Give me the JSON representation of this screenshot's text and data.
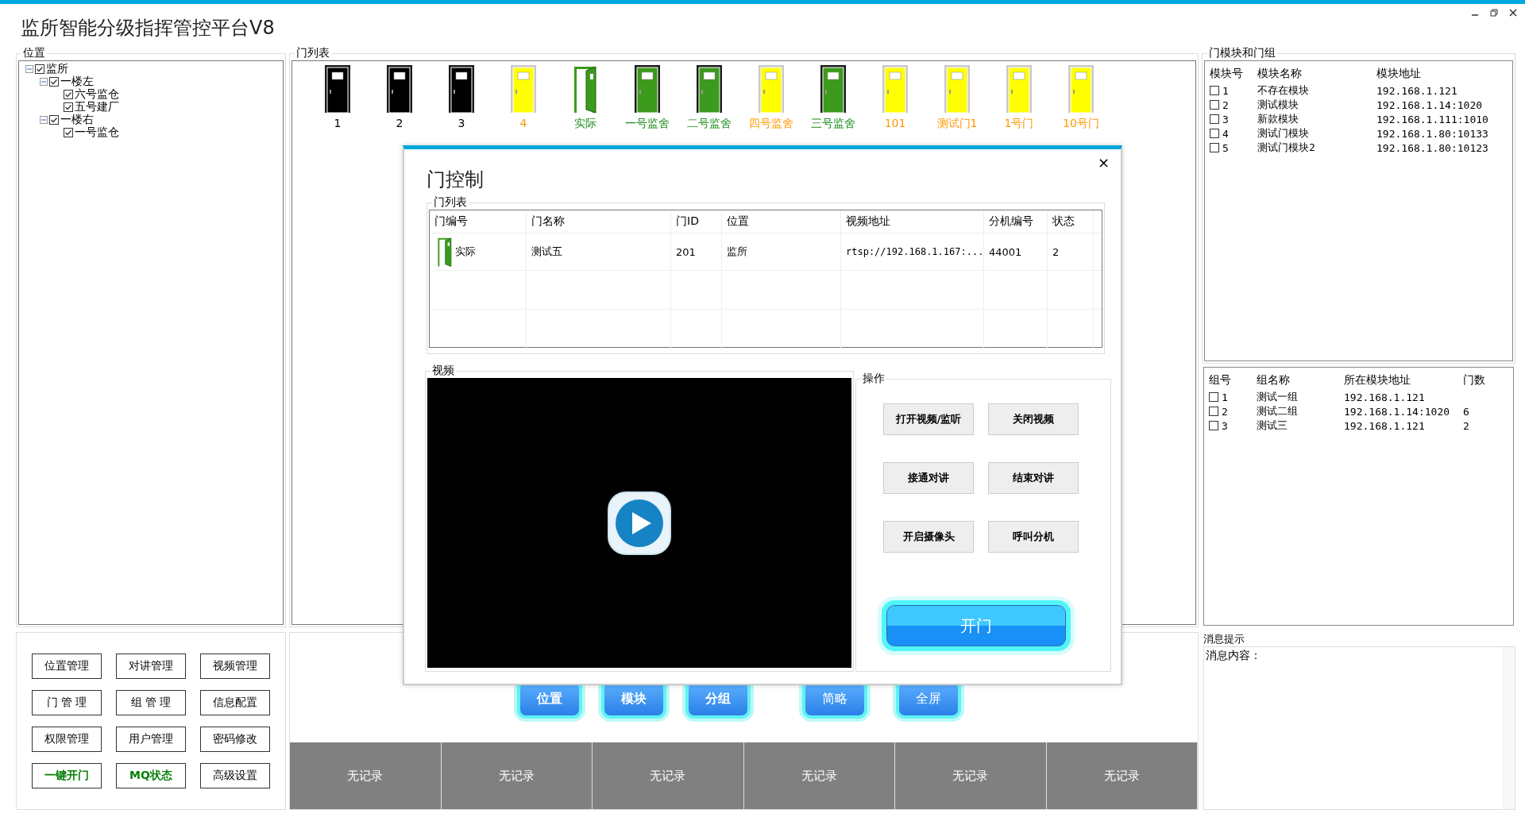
{
  "window": {
    "title": "监所智能分级指挥管控平台V8",
    "controls": [
      {
        "kind": "minimize"
      },
      {
        "kind": "restore"
      },
      {
        "kind": "close"
      }
    ]
  },
  "location": {
    "title": "位置",
    "tree": [
      {
        "label": "监所",
        "checked": true,
        "expanded": true,
        "children": [
          {
            "label": "一楼左",
            "checked": true,
            "expanded": true,
            "children": [
              {
                "label": "六号监仓",
                "checked": true
              },
              {
                "label": "五号建厂",
                "checked": true
              }
            ]
          },
          {
            "label": "一楼右",
            "checked": true,
            "expanded": true,
            "children": [
              {
                "label": "一号监仓",
                "checked": true
              }
            ]
          }
        ]
      }
    ]
  },
  "door_list": {
    "title": "门列表",
    "doors": [
      {
        "label": "1",
        "kind": "closed",
        "color": "#000000"
      },
      {
        "label": "2",
        "kind": "closed",
        "color": "#000000"
      },
      {
        "label": "3",
        "kind": "closed",
        "color": "#000000"
      },
      {
        "label": "4",
        "kind": "closed",
        "color": "#ffff00"
      },
      {
        "label": "实际",
        "kind": "open",
        "color": "#3c9a1c"
      },
      {
        "label": "一号监舍",
        "kind": "closed",
        "color": "#3c9a1c"
      },
      {
        "label": "二号监舍",
        "kind": "closed",
        "color": "#3c9a1c"
      },
      {
        "label": "四号监舍",
        "kind": "closed",
        "color": "#ffff00"
      },
      {
        "label": "三号监舍",
        "kind": "closed",
        "color": "#3c9a1c"
      },
      {
        "label": "101",
        "kind": "closed",
        "color": "#ffff00"
      },
      {
        "label": "测试门1",
        "kind": "closed",
        "color": "#ffff00"
      },
      {
        "label": "1号门",
        "kind": "closed",
        "color": "#ffff00"
      },
      {
        "label": "10号门",
        "kind": "closed",
        "color": "#ffff00"
      }
    ]
  },
  "modules": {
    "title": "门模块和门组",
    "columns": [
      "模块号",
      "模块名称",
      "模块地址"
    ],
    "rows": [
      {
        "checked": false,
        "cells": [
          "1",
          "不存在模块",
          "192.168.1.121"
        ]
      },
      {
        "checked": false,
        "cells": [
          "2",
          "测试模块",
          "192.168.1.14:1020"
        ]
      },
      {
        "checked": false,
        "cells": [
          "3",
          "新款模块",
          "192.168.1.111:1010"
        ]
      },
      {
        "checked": false,
        "cells": [
          "4",
          "测试门模块",
          "192.168.1.80:10133"
        ]
      },
      {
        "checked": false,
        "cells": [
          "5",
          "测试门模块2",
          "192.168.1.80:10123"
        ]
      }
    ]
  },
  "groups": {
    "columns": [
      "组号",
      "组名称",
      "所在模块地址",
      "门数"
    ],
    "rows": [
      {
        "checked": false,
        "cells": [
          "1",
          "测试一组",
          "192.168.1.121",
          ""
        ]
      },
      {
        "checked": false,
        "cells": [
          "2",
          "测试二组",
          "192.168.1.14:1020",
          "6"
        ]
      },
      {
        "checked": false,
        "cells": [
          "3",
          "测试三",
          "192.168.1.121",
          "2"
        ]
      }
    ]
  },
  "menu_buttons": [
    {
      "label": "位置管理",
      "kind": "normal"
    },
    {
      "label": "对讲管理",
      "kind": "normal"
    },
    {
      "label": "视频管理",
      "kind": "normal"
    },
    {
      "label": "门 管 理",
      "kind": "normal"
    },
    {
      "label": "组 管 理",
      "kind": "normal"
    },
    {
      "label": "信息配置",
      "kind": "normal"
    },
    {
      "label": "权限管理",
      "kind": "normal"
    },
    {
      "label": "用户管理",
      "kind": "normal"
    },
    {
      "label": "密码修改",
      "kind": "normal"
    },
    {
      "label": "一键开门",
      "kind": "highlight"
    },
    {
      "label": "MQ状态",
      "kind": "highlight"
    },
    {
      "label": "高级设置",
      "kind": "normal"
    }
  ],
  "view_buttons": [
    {
      "label": "位置",
      "kind": "bold"
    },
    {
      "label": "模块",
      "kind": "bold"
    },
    {
      "label": "分组",
      "kind": "bold"
    },
    {
      "label": "简略",
      "kind": "regular"
    },
    {
      "label": "全屏",
      "kind": "regular"
    }
  ],
  "records": [
    "无记录",
    "无记录",
    "无记录",
    "无记录",
    "无记录",
    "无记录"
  ],
  "messages": {
    "title": "消息提示",
    "label": "消息内容："
  },
  "dialog": {
    "title": "门控制",
    "close": "×",
    "door_table": {
      "title": "门列表",
      "columns": [
        "门编号",
        "门名称",
        "门ID",
        "位置",
        "视频地址",
        "分机编号",
        "状态"
      ],
      "rows": [
        {
          "kind": "open",
          "cells": [
            "实际",
            "测试五",
            "201",
            "监所",
            "rtsp://192.168.1.167:...",
            "44001",
            "2"
          ]
        }
      ]
    },
    "video": {
      "title": "视频"
    },
    "operations": {
      "title": "操作",
      "buttons": [
        "打开视频/监听",
        "关闭视频",
        "接通对讲",
        "结束对讲",
        "开启摄像头",
        "呼叫分机"
      ],
      "primary": "开门"
    }
  }
}
